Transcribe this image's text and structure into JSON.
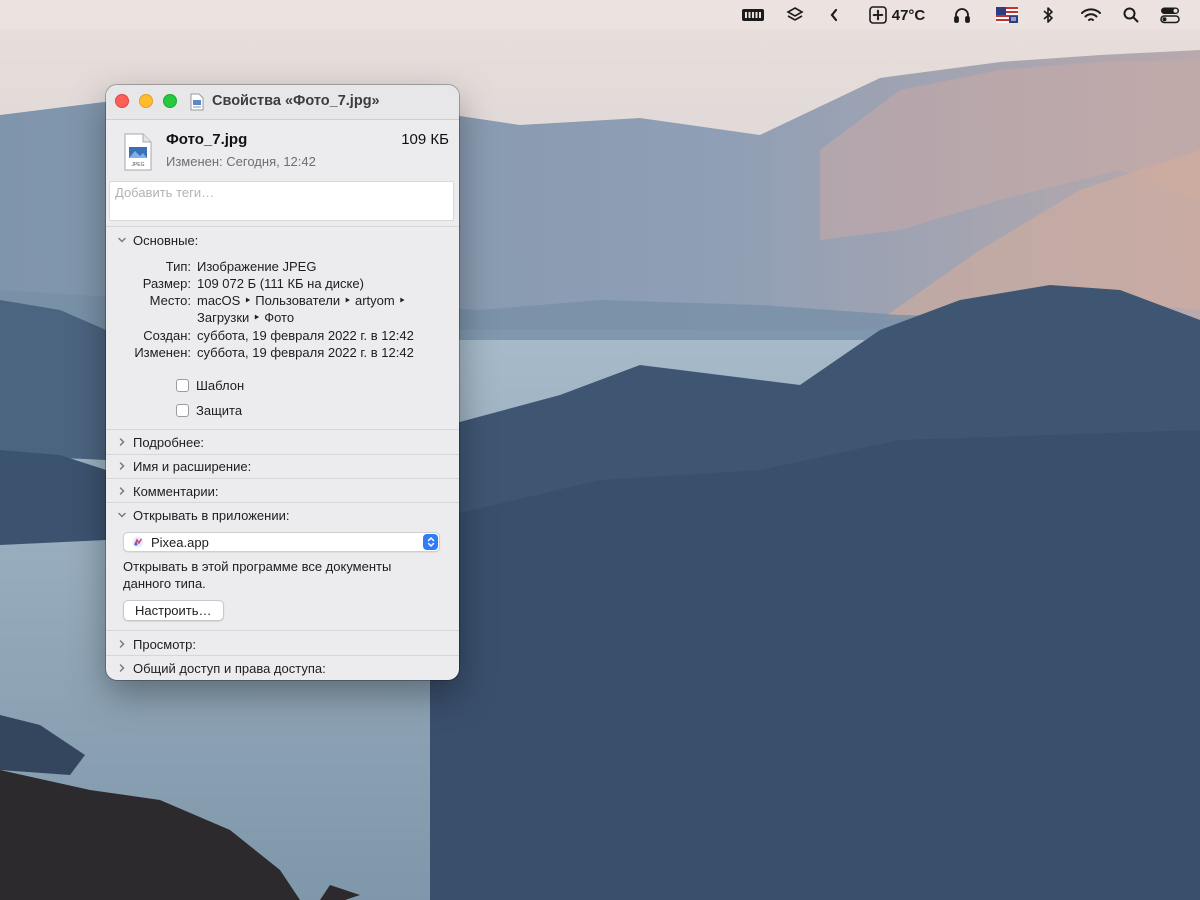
{
  "menubar": {
    "temperature": "47°C",
    "icons": [
      "battery-menu-icon",
      "layers-icon",
      "chevron-left-icon",
      "fan-icon",
      "headphones-icon",
      "us-flag-input-icon",
      "bluetooth-icon",
      "wifi-icon",
      "spotlight-search-icon",
      "control-center-icon"
    ]
  },
  "window": {
    "title": "Свойства «Фото_7.jpg»",
    "file": {
      "name": "Фото_7.jpg",
      "size": "109 КБ",
      "modified": "Изменен: Сегодня, 12:42"
    },
    "tags_placeholder": "Добавить теги…",
    "sections": {
      "general": {
        "title": "Основные:",
        "expanded": true,
        "fields": [
          {
            "label": "Тип:",
            "value": "Изображение JPEG"
          },
          {
            "label": "Размер:",
            "value": "109 072 Б (111 КБ на диске)"
          },
          {
            "label": "Место:",
            "value": "macOS ‣ Пользователи ‣ artyom ‣",
            "value2": "Загрузки ‣ Фото"
          },
          {
            "label": "Создан:",
            "value": "суббота, 19 февраля 2022 г. в 12:42"
          },
          {
            "label": "Изменен:",
            "value": "суббота, 19 февраля 2022 г. в 12:42"
          }
        ],
        "checkboxes": [
          {
            "label": "Шаблон",
            "checked": false
          },
          {
            "label": "Защита",
            "checked": false
          }
        ]
      },
      "more_info": {
        "title": "Подробнее:",
        "expanded": false
      },
      "name_ext": {
        "title": "Имя и расширение:",
        "expanded": false
      },
      "comments": {
        "title": "Комментарии:",
        "expanded": false
      },
      "open_with": {
        "title": "Открывать в приложении:",
        "expanded": true,
        "app": "Pixea.app",
        "description": "Открывать в этой программе все документы данного типа.",
        "button": "Настроить…"
      },
      "preview": {
        "title": "Просмотр:",
        "expanded": false
      },
      "sharing": {
        "title": "Общий доступ и права доступа:",
        "expanded": false
      }
    }
  },
  "colors": {
    "accent": "#2f7cf6",
    "close": "#fe5f57",
    "minimize": "#febc2e",
    "zoom": "#28c840"
  }
}
